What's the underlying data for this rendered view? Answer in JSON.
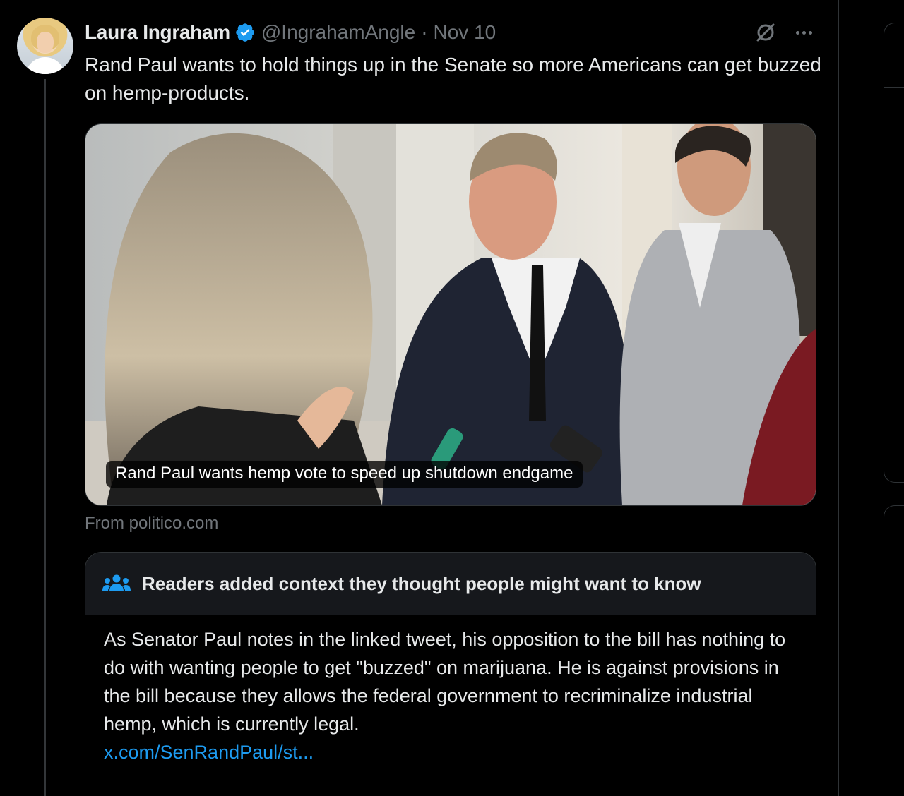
{
  "tweet": {
    "author_name": "Laura Ingraham",
    "handle": "@IngrahamAngle",
    "separator": "·",
    "date": "Nov 10",
    "text": "Rand Paul wants to hold things up in the Senate so more Americans can get buzzed on hemp-products."
  },
  "link_card": {
    "title": "Rand Paul wants hemp vote to speed up shutdown endgame",
    "source": "From politico.com"
  },
  "community_note": {
    "header": "Readers added context they thought people might want to know",
    "body": "As Senator Paul notes in the linked tweet, his opposition to the bill has nothing to do with wanting people to get \"buzzed\" on marijuana.  He is against provisions in the bill because they allows the federal government to recriminalize industrial hemp, which is currently legal.",
    "link": "x.com/SenRandPaul/st..."
  },
  "icons": {
    "verified": "verified-badge-icon",
    "grok": "grok-icon",
    "more": "more-icon",
    "note": "people-icon"
  },
  "colors": {
    "background": "#000000",
    "text": "#e7e9ea",
    "muted": "#71767b",
    "accent": "#1d9bf0",
    "border": "#2f3336"
  }
}
